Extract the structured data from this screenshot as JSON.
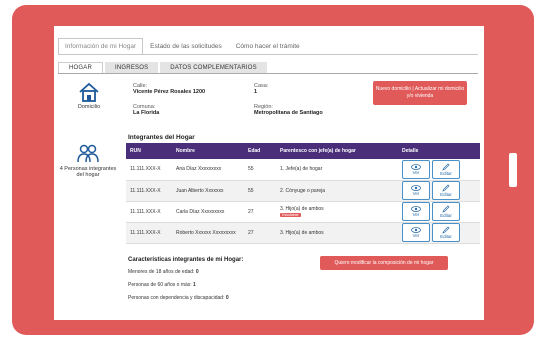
{
  "tabs": [
    {
      "label": "Información de mi Hogar",
      "active": true
    },
    {
      "label": "Estado de las solicitudes",
      "active": false
    },
    {
      "label": "Cómo hacer el trámite",
      "active": false
    }
  ],
  "subtabs": [
    {
      "label": "HOGAR",
      "active": true
    },
    {
      "label": "INGRESOS",
      "active": false
    },
    {
      "label": "DATOS COMPLEMENTARIOS",
      "active": false
    }
  ],
  "sidebar": {
    "domicilio_label": "Domicilio",
    "integrantes_label": "4 Personas integrantes del hogar"
  },
  "address": {
    "calle_label": "Calle:",
    "calle_value": "Vicente Pérez Rosales 1200",
    "casa_label": "Casa:",
    "casa_value": "1",
    "comuna_label": "Comuna:",
    "comuna_value": "La Florida",
    "region_label": "Región:",
    "region_value": "Metropolitana de Santiago"
  },
  "buttons": {
    "update_address": "Nuevo domicilio | Actualizar mi domicilio y/o vivienda",
    "modify_composition": "Quiero modificar la composición de mi hogar"
  },
  "members_title": "Integrantes del Hogar",
  "table": {
    "headers": [
      "RUN",
      "Nombre",
      "Edad",
      "Parentesco con jefe(a) de hogar",
      "Detalle"
    ],
    "rows": [
      {
        "run": "11.111.XXX-X",
        "nombre": "Ana Díaz Xxxxxxxxx",
        "edad": "55",
        "parentesco": "1. Jefe(a) de hogar",
        "badge": ""
      },
      {
        "run": "11.111.XXX-X",
        "nombre": "Juan Alberto Xxxxxxx",
        "edad": "55",
        "parentesco": "2. Cónyuge o pareja",
        "badge": ""
      },
      {
        "run": "11.111.XXX-X",
        "nombre": "Carla Díaz Xxxxxxxxx",
        "edad": "27",
        "parentesco": "3. Hijo(a) de ambos",
        "badge": "Estudiante"
      },
      {
        "run": "11.111.XXX-X",
        "nombre": "Roberto Xxxxxx Xxxxxxxxx",
        "edad": "27",
        "parentesco": "3. Hijo(a) de ambos",
        "badge": ""
      }
    ],
    "view_label": "Ver",
    "edit_label": "Editar"
  },
  "characteristics": {
    "title": "Características integrantes de mi Hogar:",
    "line1_label": "Menores de 18 años de edad:",
    "line1_value": "0",
    "line2_label": "Personas de 60 años o más:",
    "line2_value": "1",
    "line3_label": "Personas con dependencia y discapacidad:",
    "line3_value": "0"
  },
  "colors": {
    "accent": "#e05a5a",
    "header": "#4a2e7a",
    "action_border": "#4a90c8"
  }
}
